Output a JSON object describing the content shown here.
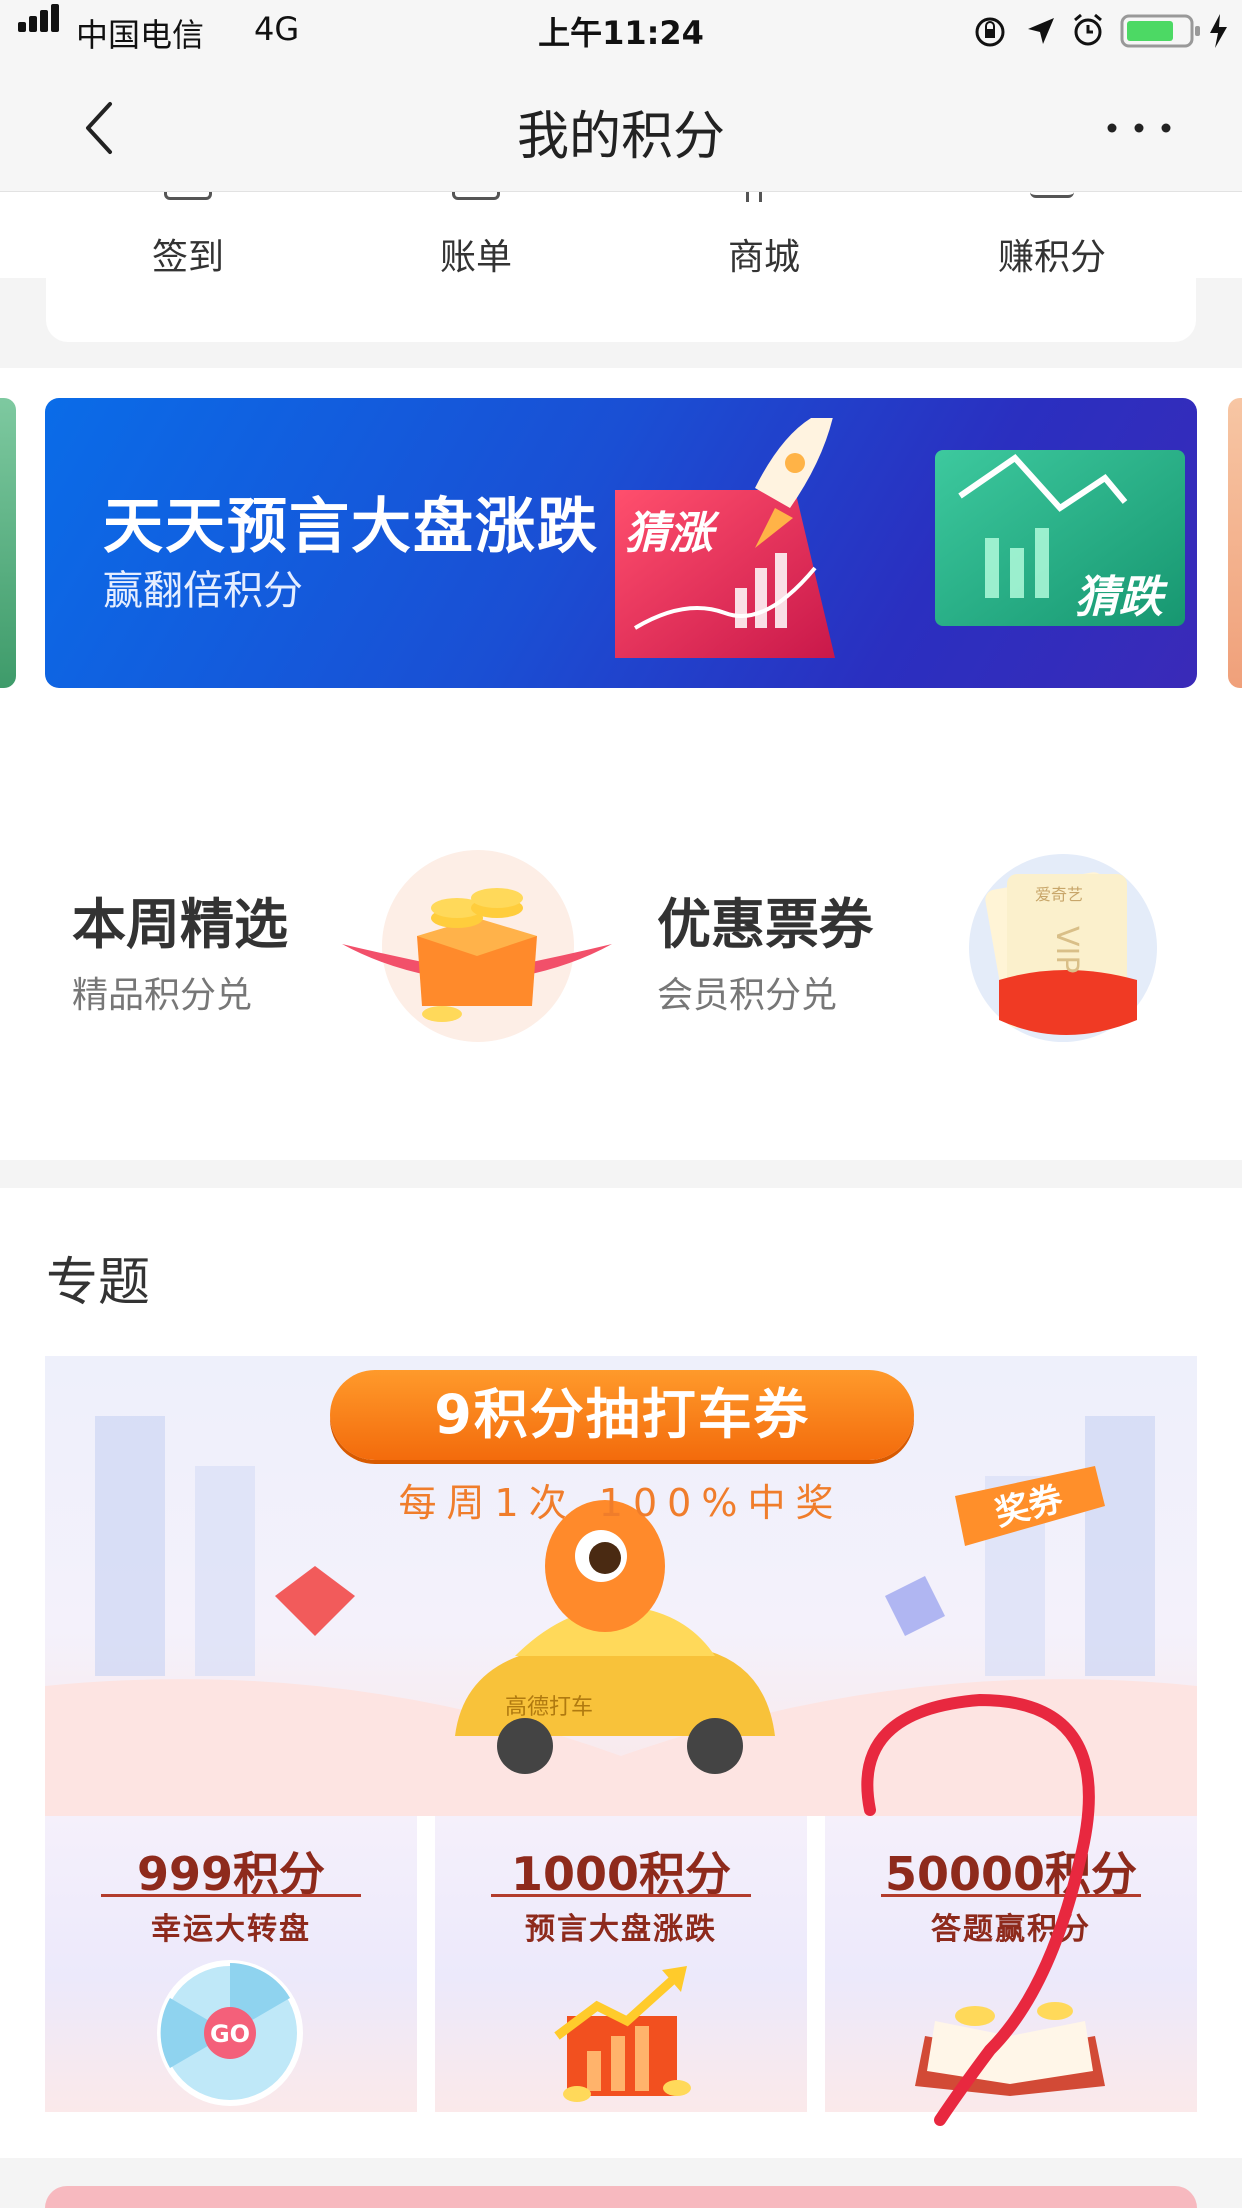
{
  "status_bar": {
    "carrier": "中国电信",
    "network": "4G",
    "time": "上午11:24"
  },
  "nav": {
    "title": "我的积分",
    "back_icon": "chevron-left-icon",
    "more_icon": "more-dots-icon"
  },
  "quick_actions": [
    {
      "label": "签到"
    },
    {
      "label": "账单"
    },
    {
      "label": "商城"
    },
    {
      "label": "赚积分"
    }
  ],
  "banner": {
    "title": "天天预言大盘涨跌",
    "subtitle": "赢翻倍积分",
    "tag_up": "猜涨",
    "tag_down": "猜跌"
  },
  "selections": [
    {
      "title": "本周精选",
      "subtitle": "精品积分兑"
    },
    {
      "title": "优惠票券",
      "subtitle": "会员积分兑",
      "ticket_brand": "爱奇艺",
      "ticket_text": "VIP"
    }
  ],
  "topics": {
    "header": "专题",
    "promo": {
      "title": "9积分抽打车券",
      "subtitle": "每周1次 100%中奖",
      "tag": "奖券",
      "car_text": "高德打车"
    },
    "tiles": [
      {
        "amount": "999积分",
        "label": "幸运大转盘",
        "icon_text": "GO"
      },
      {
        "amount": "1000积分",
        "label": "预言大盘涨跌"
      },
      {
        "amount": "50000积分",
        "label": "答题赢积分"
      }
    ]
  },
  "colors": {
    "accent_orange": "#f36b0c",
    "banner_blue": "#1a4fd4",
    "tile_text": "#8e2a1c",
    "annotation_red": "#e8283f"
  }
}
